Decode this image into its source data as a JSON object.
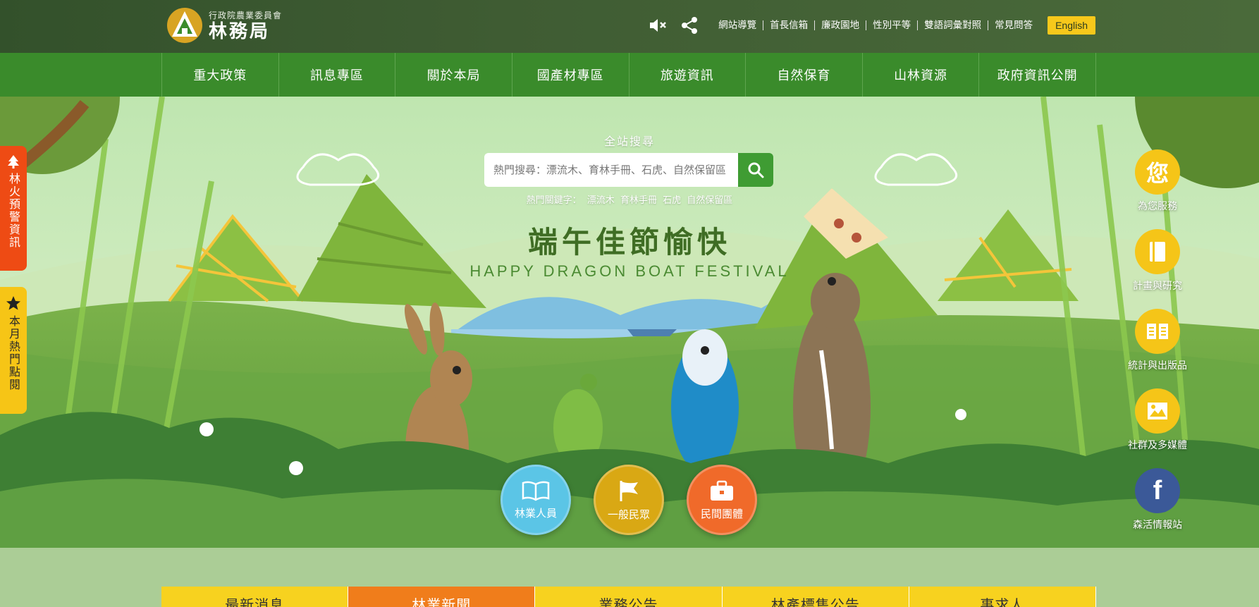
{
  "header": {
    "logo_sub": "行政院農業委員會",
    "logo_main": "林務局",
    "top_links": [
      "網站導覽",
      "首長信箱",
      "廉政園地",
      "性別平等",
      "雙語詞彙對照",
      "常見問答"
    ],
    "lang_button": "English",
    "icons": [
      "mute-icon",
      "share-icon"
    ]
  },
  "nav": {
    "items": [
      "重大政策",
      "訊息專區",
      "關於本局",
      "國產材專區",
      "旅遊資訊",
      "自然保育",
      "山林資源",
      "政府資訊公開"
    ]
  },
  "search": {
    "label": "全站搜尋",
    "placeholder": "熱門搜尋：漂流木、育林手冊、石虎、自然保留區",
    "hot_prefix": "熱門關鍵字：",
    "hot_keywords": [
      "漂流木",
      "育林手冊",
      "石虎",
      "自然保留區"
    ]
  },
  "banner": {
    "title": "端午佳節愉快",
    "subtitle": "HAPPY DRAGON BOAT FESTIVAL"
  },
  "side_tabs": {
    "fire": "林火預警資訊",
    "hot": "本月熱門點閱"
  },
  "quick_links": [
    {
      "label": "為您服務",
      "icon": "service-icon"
    },
    {
      "label": "計畫與研究",
      "icon": "book-icon"
    },
    {
      "label": "統計與出版品",
      "icon": "open-book-icon"
    },
    {
      "label": "社群及多媒體",
      "icon": "image-icon"
    },
    {
      "label": "森活情報站",
      "icon": "facebook-icon"
    }
  ],
  "quick_service_glyph": "您",
  "roles": [
    {
      "label": "林業人員",
      "color": "#5bc5e6",
      "icon": "open-book-icon"
    },
    {
      "label": "一般民眾",
      "color": "#d9a814",
      "icon": "flag-icon"
    },
    {
      "label": "民間團體",
      "color": "#f06a2a",
      "icon": "briefcase-icon"
    }
  ],
  "news_tabs": {
    "items": [
      "最新消息",
      "林業新聞",
      "業務公告",
      "林產標售公告",
      "事求人"
    ],
    "active_index": 1
  },
  "colors": {
    "header_bg": "#3f5c33",
    "nav_bg": "#3a8b2b",
    "accent_yellow": "#f5c518",
    "fire_tab": "#ee4b14",
    "active_tab": "#f07d1b"
  }
}
